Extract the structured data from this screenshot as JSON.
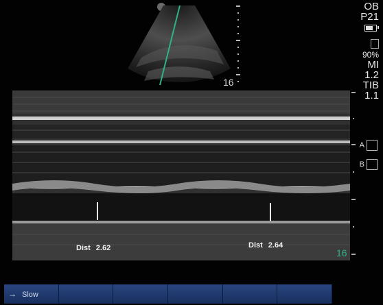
{
  "status": {
    "mode": "OB",
    "probe": "P21",
    "battery_level": "90%",
    "mi_label": "MI",
    "mi_value": "1.2",
    "tib_label": "TIB",
    "tib_value": "1.1"
  },
  "sector": {
    "depth": "16"
  },
  "markers": {
    "a": "A",
    "b": "B"
  },
  "mmode": {
    "depth": "16",
    "measurements": [
      {
        "label": "Dist",
        "value": "2.62"
      },
      {
        "label": "Dist",
        "value": "2.64"
      }
    ]
  },
  "softkeys": [
    {
      "arrow": "→",
      "label": "Slow"
    },
    {
      "arrow": "",
      "label": ""
    },
    {
      "arrow": "",
      "label": ""
    },
    {
      "arrow": "",
      "label": ""
    },
    {
      "arrow": "",
      "label": ""
    },
    {
      "arrow": "",
      "label": ""
    }
  ],
  "colors": {
    "accent_green": "#2eb28a",
    "softkey_blue": "#24407a"
  }
}
